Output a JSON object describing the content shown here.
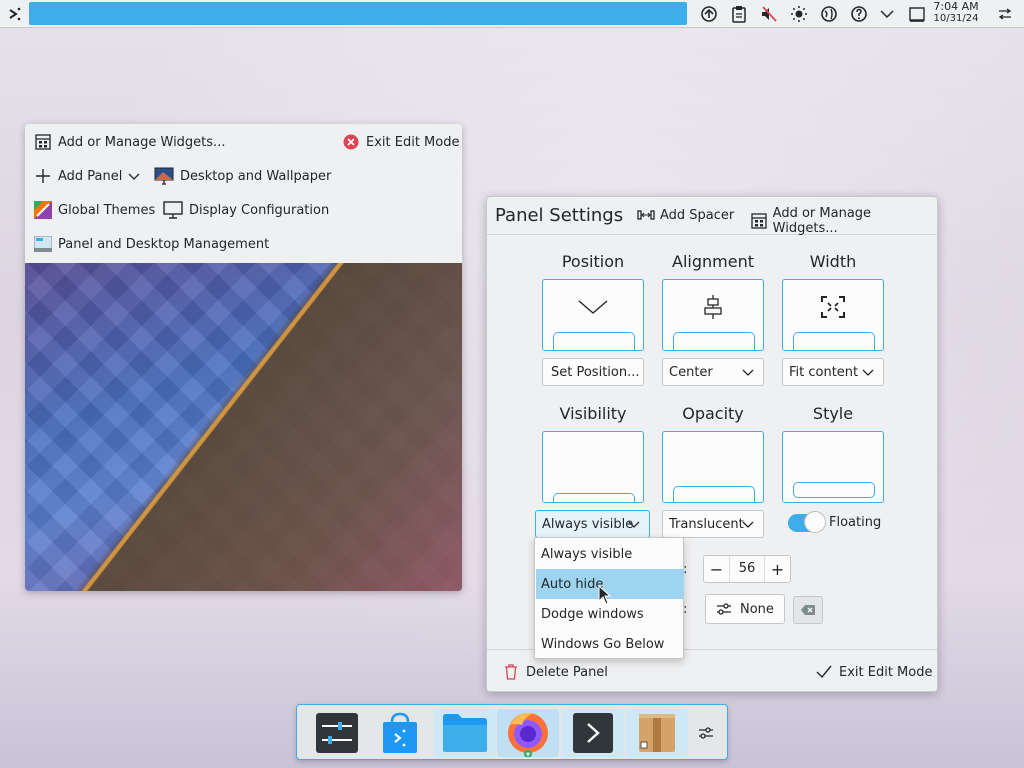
{
  "top_panel": {
    "left_icon": "kickoff-arrow-icon",
    "tray_icons": [
      "network-icon",
      "clipboard-icon",
      "volume-muted-icon",
      "brightness-icon",
      "globe-icon",
      "help-icon",
      "chevron-down-icon",
      "show-desktop-icon",
      "panel-settings-icon"
    ],
    "clock": {
      "time": "7:04 AM",
      "date": "10/31/24"
    }
  },
  "toolbox": {
    "add_widgets": "Add or Manage Widgets...",
    "exit_edit_mode": "Exit Edit Mode",
    "add_panel": "Add Panel",
    "desktop_wallpaper": "Desktop and Wallpaper",
    "global_themes": "Global Themes",
    "display_configuration": "Display Configuration",
    "panel_desktop_management": "Panel and Desktop Management"
  },
  "panel_settings": {
    "title": "Panel Settings",
    "add_spacer": "Add Spacer",
    "add_widgets": "Add or Manage Widgets...",
    "sections": {
      "position": {
        "label": "Position",
        "control": "Set Position..."
      },
      "alignment": {
        "label": "Alignment",
        "value": "Center"
      },
      "width": {
        "label": "Width",
        "value": "Fit content"
      },
      "visibility": {
        "label": "Visibility",
        "value": "Always visible"
      },
      "opacity": {
        "label": "Opacity",
        "value": "Translucent"
      },
      "style": {
        "label": "Style",
        "toggle_label": "Floating",
        "floating": true
      }
    },
    "height_label_partial": "t:",
    "height_value": "56",
    "shortcut_label_partial": "t:",
    "shortcut_value": "None",
    "delete_panel": "Delete Panel",
    "exit_edit_mode": "Exit Edit Mode"
  },
  "visibility_dropdown": {
    "options": [
      "Always visible",
      "Auto hide",
      "Dodge windows",
      "Windows Go Below"
    ],
    "highlighted": "Auto hide"
  },
  "dock": {
    "items": [
      "system-settings-icon",
      "discover-store-icon",
      "file-manager-icon",
      "firefox-icon",
      "terminal-icon",
      "package-archive-icon",
      "panel-configure-icon"
    ]
  },
  "colors": {
    "accent": "#3daee9",
    "highlight": "#9fd4f1",
    "window_bg": "#eff0f1"
  }
}
